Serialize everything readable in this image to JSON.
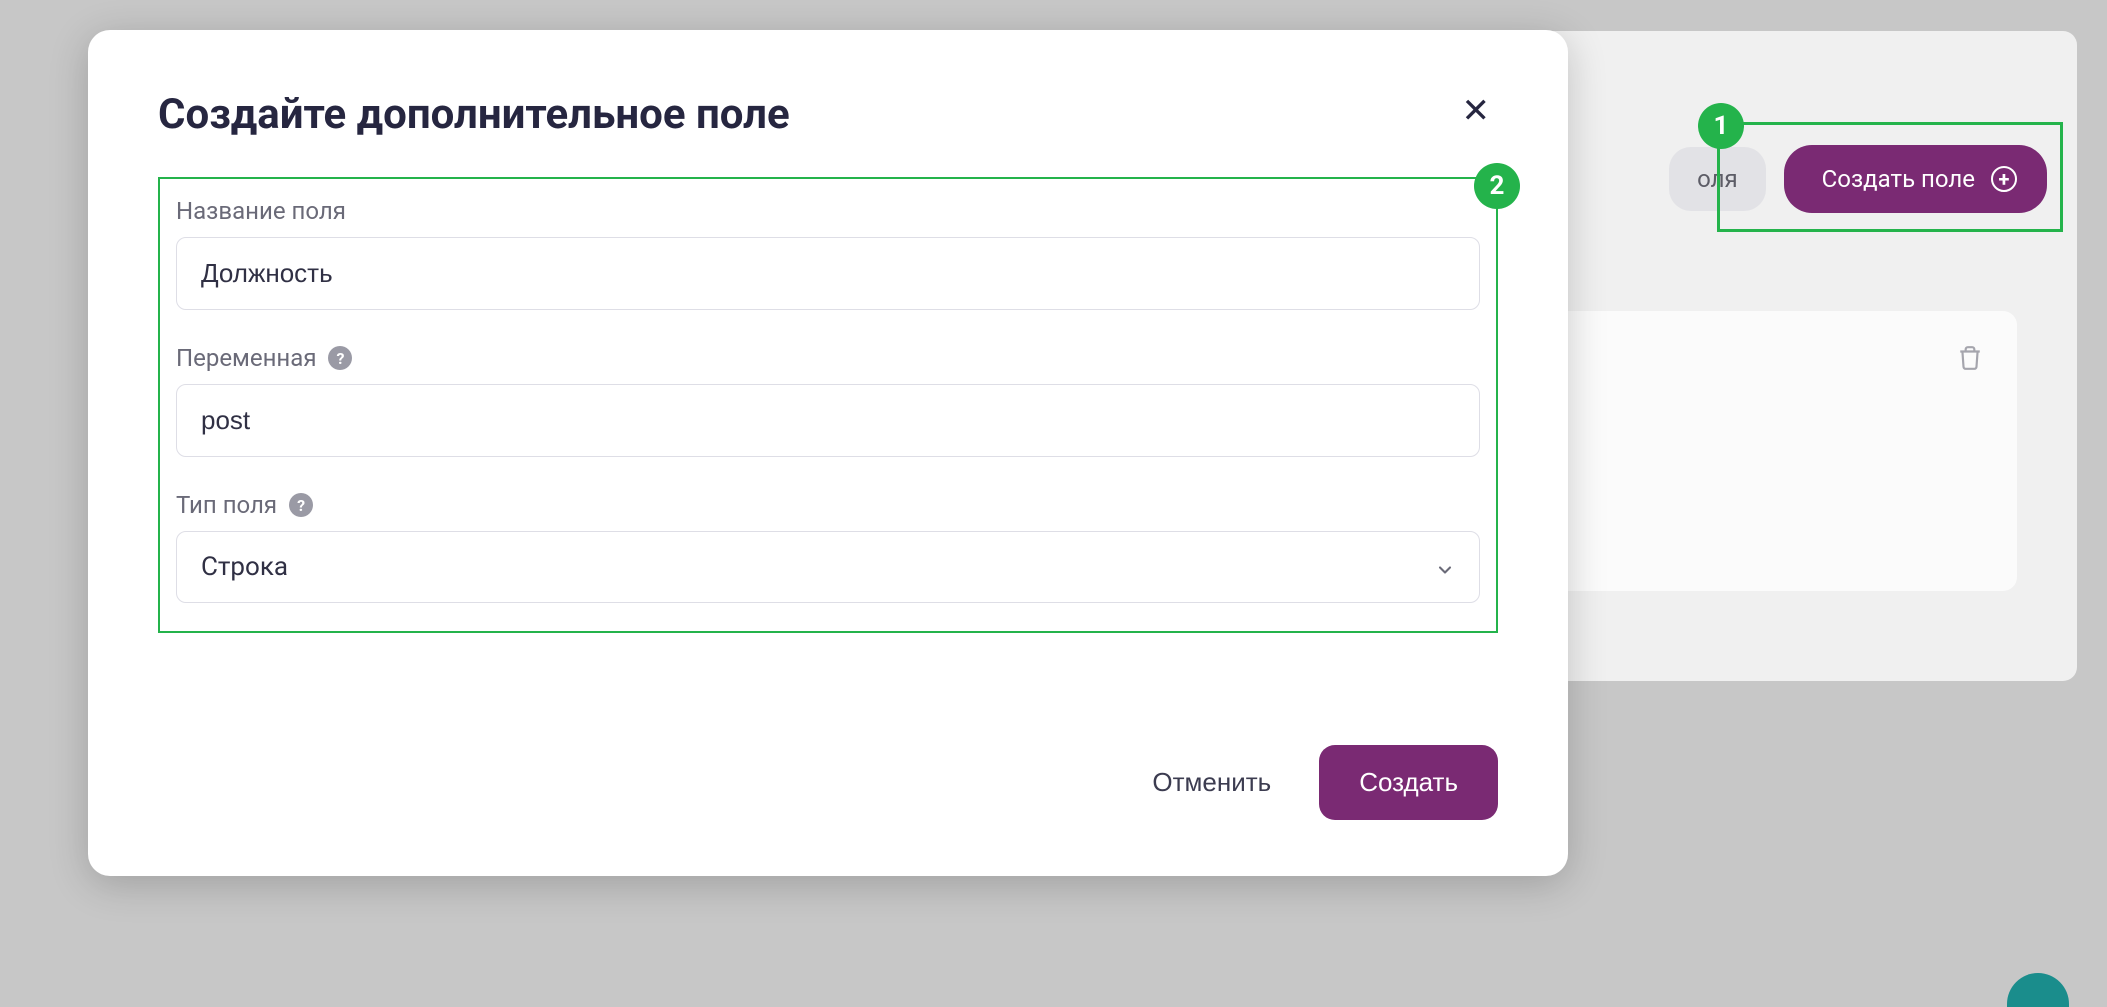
{
  "background": {
    "partial_pill_text": "оля",
    "create_field_button": "Создать поле",
    "annotation_1": "1"
  },
  "modal": {
    "title": "Создайте дополнительное поле",
    "annotation_2": "2",
    "fields": {
      "name": {
        "label": "Название поля",
        "value": "Должность"
      },
      "variable": {
        "label": "Переменная",
        "value": "post"
      },
      "type": {
        "label": "Тип поля",
        "value": "Строка"
      }
    },
    "footer": {
      "cancel": "Отменить",
      "submit": "Создать"
    }
  }
}
